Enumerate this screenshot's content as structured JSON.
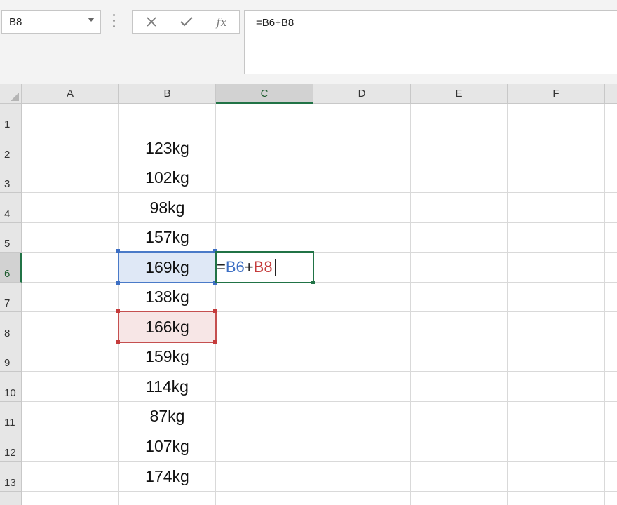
{
  "formula_bar": {
    "name_box_value": "B8",
    "cancel_icon": "x-icon",
    "confirm_icon": "check-icon",
    "fx_label": "fx",
    "formula_text": "=B6+B8"
  },
  "sheet": {
    "columns": [
      "A",
      "B",
      "C",
      "D",
      "E",
      "F"
    ],
    "active_column": "C",
    "rows": [
      "1",
      "2",
      "3",
      "4",
      "5",
      "6",
      "7",
      "8",
      "9",
      "10",
      "11",
      "12",
      "13"
    ],
    "active_row": "6",
    "column_b_values": [
      "",
      "123kg",
      "102kg",
      "98kg",
      "157kg",
      "169kg",
      "138kg",
      "166kg",
      "159kg",
      "114kg",
      "87kg",
      "107kg",
      "174kg"
    ],
    "editing_cell": {
      "address": "C6",
      "parts": {
        "eq": "=",
        "ref1": "B6",
        "op": "+",
        "ref2": "B8"
      }
    },
    "colors": {
      "ref1": "#3d6fc4",
      "ref2": "#c53b3b",
      "active": "#217346"
    }
  }
}
